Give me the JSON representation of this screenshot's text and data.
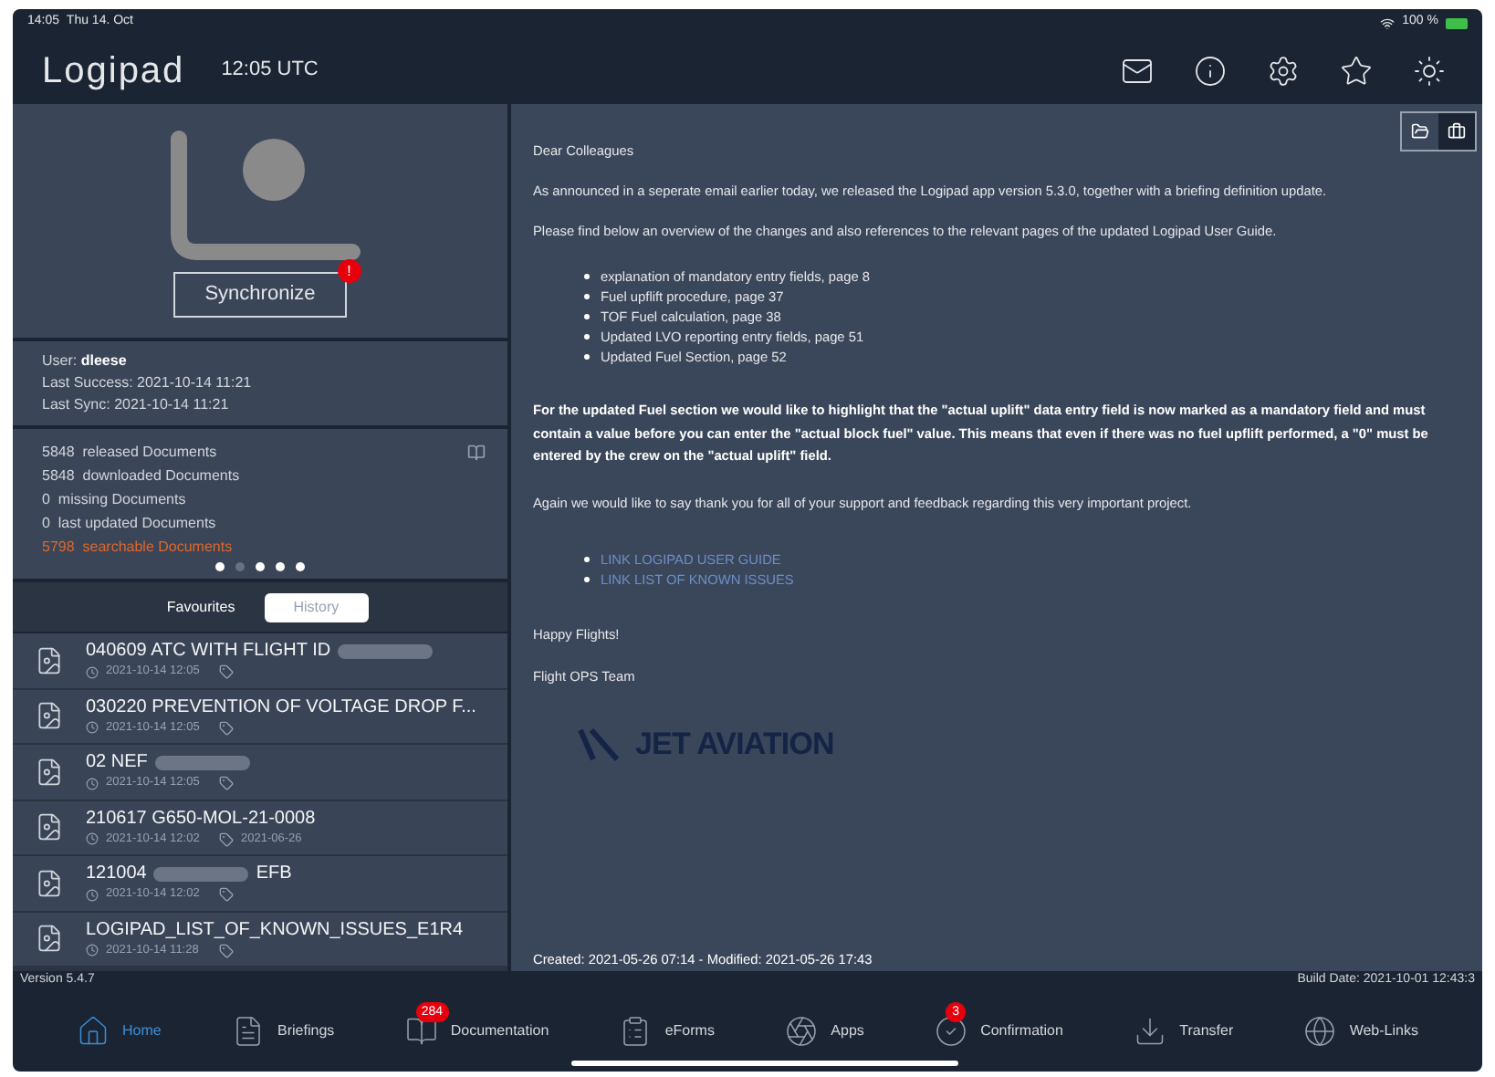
{
  "status_bar": {
    "time": "14:05",
    "date": "Thu 14. Oct",
    "battery": "100 %"
  },
  "header": {
    "logo": "Logipad",
    "utc": "12:05 UTC"
  },
  "sync": {
    "button": "Synchronize",
    "alert": "!"
  },
  "user": {
    "label": "User:",
    "name": "dleese",
    "last_success": "Last Success: 2021-10-14 11:21",
    "last_sync": "Last Sync: 2021-10-14 11:21"
  },
  "documents": [
    {
      "count": "5848",
      "label": "released Documents",
      "highlight": false
    },
    {
      "count": "5848",
      "label": "downloaded Documents",
      "highlight": false
    },
    {
      "count": "0",
      "label": "missing Documents",
      "highlight": false
    },
    {
      "count": "0",
      "label": "last updated Documents",
      "highlight": false
    },
    {
      "count": "5798",
      "label": "searchable Documents",
      "highlight": true
    }
  ],
  "page_dots": [
    {
      "selected": false
    },
    {
      "selected": true
    },
    {
      "selected": false
    },
    {
      "selected": false
    },
    {
      "selected": false
    }
  ],
  "list_tabs": [
    {
      "label": "Favourites",
      "selected": false
    },
    {
      "label": "History",
      "selected": true
    }
  ],
  "history": [
    {
      "title_parts": [
        {
          "kind": "text",
          "text": "040609 ATC WITH FLIGHT ID"
        },
        {
          "kind": "redacted"
        }
      ],
      "time": "2021-10-14 12:05"
    },
    {
      "title_parts": [
        {
          "kind": "text",
          "text": "030220 PREVENTION OF VOLTAGE DROP F..."
        }
      ],
      "time": "2021-10-14 12:05"
    },
    {
      "title_parts": [
        {
          "kind": "text",
          "text": "02 NEF"
        },
        {
          "kind": "redacted"
        }
      ],
      "time": "2021-10-14 12:05"
    },
    {
      "title_parts": [
        {
          "kind": "text",
          "text": "210617 G650-MOL-21-0008"
        }
      ],
      "time": "2021-10-14 12:02",
      "tag": "2021-06-26"
    },
    {
      "title_parts": [
        {
          "kind": "text",
          "text": "121004"
        },
        {
          "kind": "redacted"
        },
        {
          "kind": "text",
          "text": "EFB"
        }
      ],
      "time": "2021-10-14 12:02"
    },
    {
      "title_parts": [
        {
          "kind": "text",
          "text": "LOGIPAD_LIST_OF_KNOWN_ISSUES_E1R4"
        }
      ],
      "time": "2021-10-14 11:28"
    }
  ],
  "version": "Version  5.4.7",
  "build_date": "Build Date: 2021-10-01 12:43:3",
  "briefing": {
    "greeting": "Dear Colleagues",
    "paragraphs": [
      "As announced in a seperate email earlier today, we released the Logipad app version 5.3.0, together with a briefing definition update.",
      "Please find below an overview of the changes and also references to the relevant pages of the updated Logipad User Guide."
    ],
    "bullets": [
      "explanation of mandatory entry fields, page 8",
      "Fuel upflift procedure, page 37",
      "TOF Fuel calculation, page 38",
      "Updated LVO reporting entry fields, page 51",
      "Updated Fuel Section, page 52"
    ],
    "highlight": "For the updated Fuel section we would like to highlight that the \"actual uplift\" data entry field is now marked as a mandatory field and must contain a value before you can enter the \"actual block fuel\" value. This means that even if there was no fuel upflift performed, a \"0\" must be entered by the crew on the \"actual uplift\" field.",
    "thanks": "Again we would like to say thank you for all of your support and feedback regarding this very important project.",
    "links": [
      "LINK LOGIPAD USER GUIDE",
      "LINK LIST OF KNOWN ISSUES"
    ],
    "closing": "Happy Flights!",
    "signature": "Flight OPS Team",
    "logo": "JET AVIATION",
    "footer": "Created: 2021-05-26 07:14 - Modified: 2021-05-26 17:43"
  },
  "tabbar": [
    {
      "kind": "home",
      "label": "Home",
      "selected": true
    },
    {
      "kind": "briefings",
      "label": "Briefings",
      "selected": false
    },
    {
      "kind": "documentation",
      "label": "Documentation",
      "selected": false,
      "badge": "284"
    },
    {
      "kind": "eforms",
      "label": "eForms",
      "selected": false
    },
    {
      "kind": "apps",
      "label": "Apps",
      "selected": false
    },
    {
      "kind": "confirmation",
      "label": "Confirmation",
      "selected": false,
      "badge": "3"
    },
    {
      "kind": "transfer",
      "label": "Transfer",
      "selected": false
    },
    {
      "kind": "weblinks",
      "label": "Web-Links",
      "selected": false
    }
  ]
}
